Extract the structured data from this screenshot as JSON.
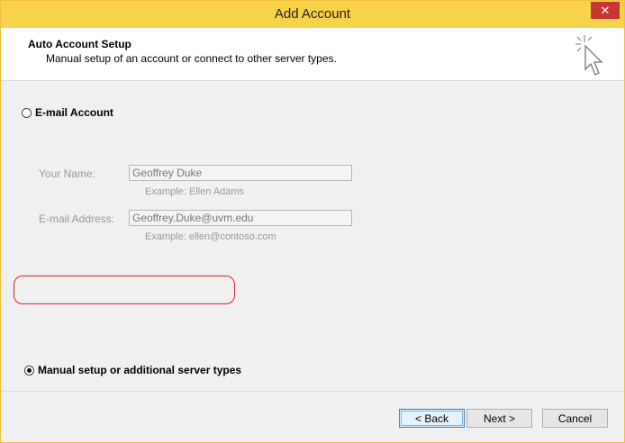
{
  "window": {
    "title": "Add Account",
    "close_glyph": "✕"
  },
  "header": {
    "title": "Auto Account Setup",
    "subtitle": "Manual setup of an account or connect to other server types.",
    "icon": "pointer-cursor-sparkle-icon"
  },
  "options": {
    "email_account_label": "E-mail Account",
    "manual_setup_label": "Manual setup or additional server types",
    "selected": "manual"
  },
  "form": {
    "name_label": "Your Name:",
    "name_value": "Geoffrey Duke",
    "name_example": "Example: Ellen Adams",
    "email_label": "E-mail Address:",
    "email_value": "Geoffrey.Duke@uvm.edu",
    "email_example": "Example: ellen@contoso.com"
  },
  "buttons": {
    "back": "< Back",
    "next": "Next >",
    "cancel": "Cancel"
  },
  "colors": {
    "titlebar": "#f7d34a",
    "close": "#c7372f",
    "highlight": "#d9232e"
  }
}
